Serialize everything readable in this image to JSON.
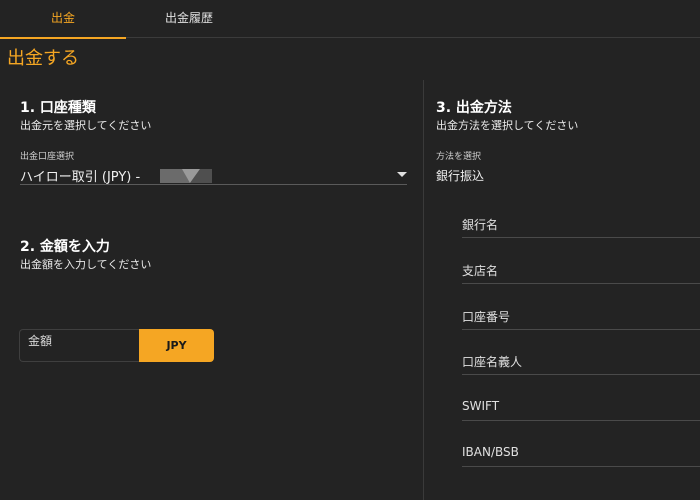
{
  "tabs": [
    {
      "label": "出金",
      "active": true
    },
    {
      "label": "出金履歴",
      "active": false
    }
  ],
  "page_title": "出金する",
  "section1": {
    "title": "1. 口座種類",
    "subtitle": "出金元を選択してください",
    "field_label": "出金口座選択",
    "selected_value": "ハイロー取引 (JPY) -"
  },
  "section2": {
    "title": "2. 金額を入力",
    "subtitle": "出金額を入力してください",
    "amount_placeholder": "金額",
    "currency": "JPY"
  },
  "section3": {
    "title": "3. 出金方法",
    "subtitle": "出金方法を選択してください",
    "field_label": "方法を選択",
    "selected_value": "銀行振込",
    "bank_fields": [
      "銀行名",
      "支店名",
      "口座番号",
      "口座名義人",
      "SWIFT",
      "IBAN/BSB"
    ]
  },
  "colors": {
    "accent": "#f5a623",
    "background": "#232323"
  }
}
